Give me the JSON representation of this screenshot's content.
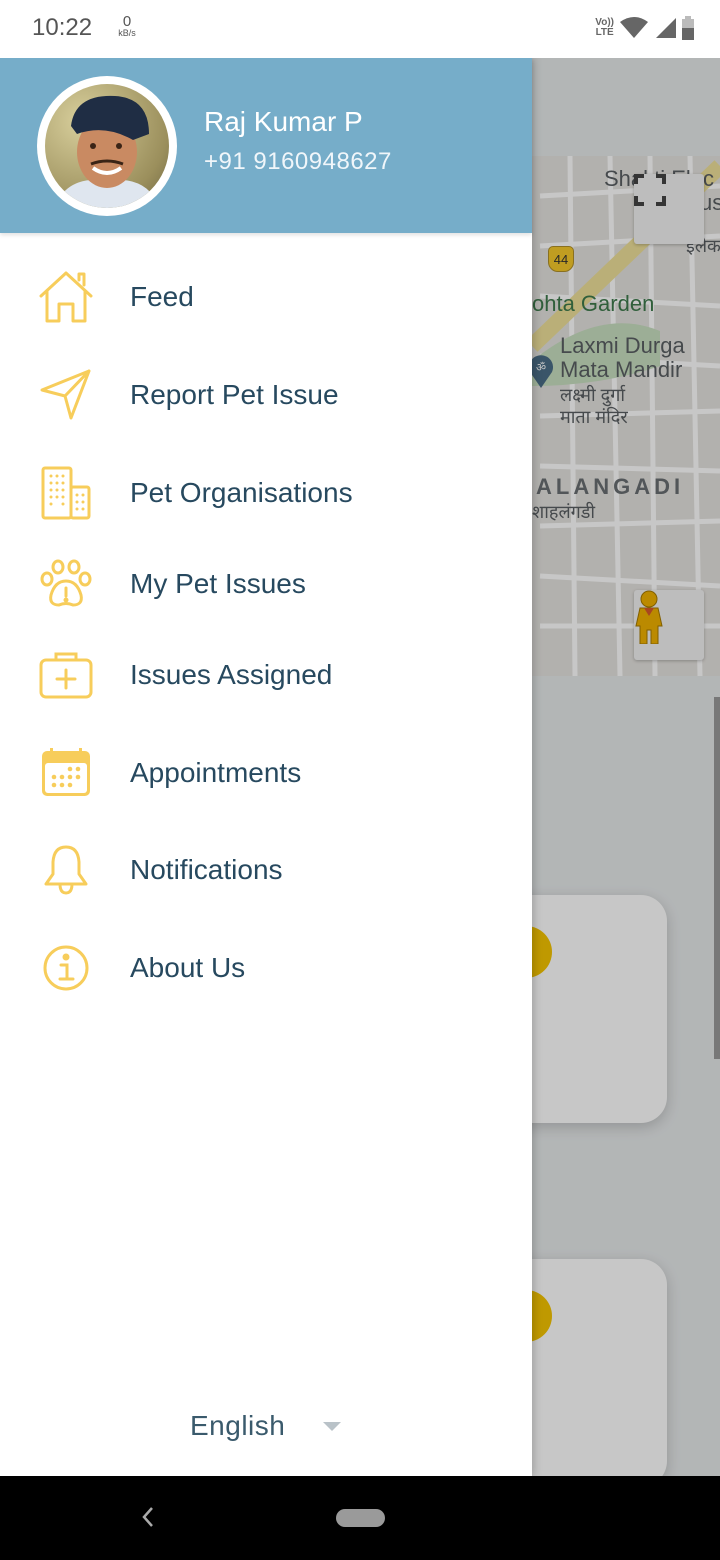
{
  "status_bar": {
    "time": "10:22",
    "net_speed_value": "0",
    "net_speed_unit": "kB/s",
    "volte_line1": "Vo))",
    "volte_line2": "LTE",
    "icons": [
      "wifi-icon",
      "signal-icon",
      "battery-icon"
    ]
  },
  "drawer": {
    "user": {
      "name": "Raj Kumar P",
      "phone": "+91 9160948627"
    },
    "header_color": "#76adc9",
    "icon_color": "#f7cd5b",
    "label_color": "#27495f",
    "menu": [
      {
        "label": "Feed",
        "icon": "home-icon"
      },
      {
        "label": "Report Pet Issue",
        "icon": "paper-plane-icon"
      },
      {
        "label": "Pet Organisations",
        "icon": "buildings-icon"
      },
      {
        "label": "My Pet Issues",
        "icon": "paw-alert-icon"
      },
      {
        "label": "Issues Assigned",
        "icon": "medical-kit-icon"
      },
      {
        "label": "Appointments",
        "icon": "calendar-icon"
      },
      {
        "label": "Notifications",
        "icon": "bell-icon"
      },
      {
        "label": "About Us",
        "icon": "info-icon"
      }
    ],
    "language": {
      "selected": "English"
    }
  },
  "background_map": {
    "labels": {
      "place1": "Shakti Elec",
      "place1b": "us",
      "place1c": "इलैक",
      "road_number": "44",
      "garden": "ohta Garden",
      "temple_line1": "Laxmi Durga",
      "temple_line2": "Mata Mandir",
      "temple_hi1": "लक्ष्मी दुर्गा",
      "temple_hi2": "माता मंदिर",
      "area": "ALANGADI",
      "area_hi": "शाहलंगडी"
    }
  }
}
